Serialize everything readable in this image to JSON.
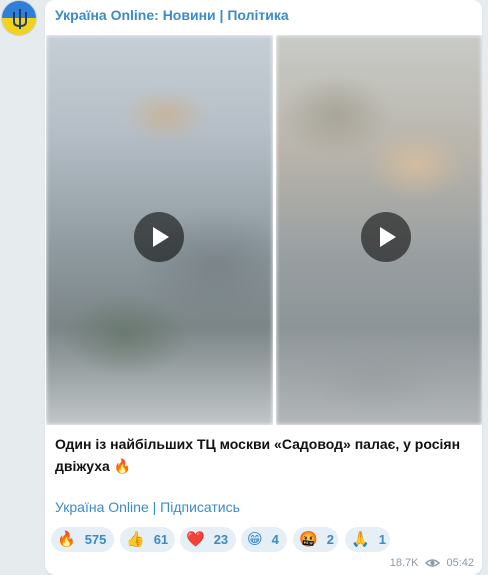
{
  "channel": {
    "name": "Україна Online: Новини | Політика"
  },
  "post": {
    "text": "Один із найбільших ТЦ москви «Садовод» палає, у росіян двіжуха 🔥",
    "footer_link": "Україна Online | Підписатись"
  },
  "media": [
    {
      "type": "video",
      "play_icon": "play-icon"
    },
    {
      "type": "video",
      "play_icon": "play-icon"
    }
  ],
  "reactions": [
    {
      "emoji": "🔥",
      "count": "575"
    },
    {
      "emoji": "👍",
      "count": "61"
    },
    {
      "emoji": "❤️",
      "count": "23"
    },
    {
      "emoji": "😁",
      "count": "4"
    },
    {
      "emoji": "🤬",
      "count": "2"
    },
    {
      "emoji": "🙏",
      "count": "1"
    }
  ],
  "meta": {
    "views": "18.7K",
    "time": "05:42"
  },
  "colors": {
    "accent": "#3a8bc8",
    "background": "#e6ebee",
    "reaction_bg": "#e6eff6"
  }
}
